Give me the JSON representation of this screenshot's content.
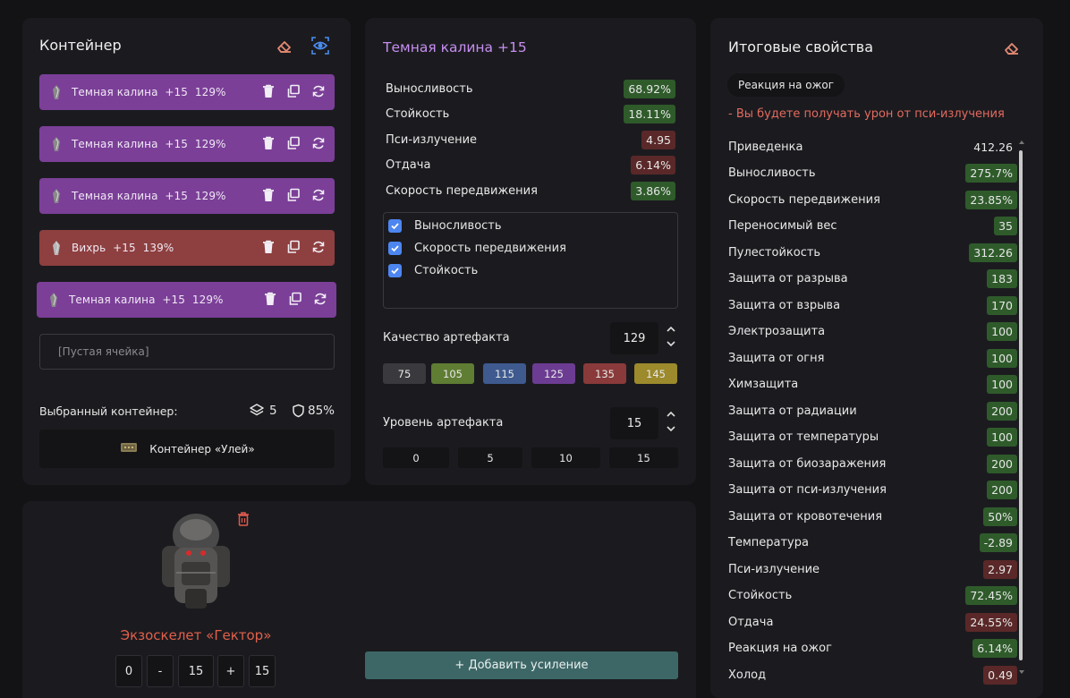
{
  "container_panel": {
    "title": "Контейнер",
    "slots": [
      {
        "label": "Темная калина  +15  129%",
        "color": "violet"
      },
      {
        "label": "Темная калина  +15  129%",
        "color": "violet"
      },
      {
        "label": "Темная калина  +15  129%",
        "color": "violet"
      },
      {
        "label": "Вихрь  +15  139%",
        "color": "red"
      },
      {
        "label": "Темная калина  +15  129%",
        "color": "violet"
      }
    ],
    "empty_slot": "[Пустая ячейка]",
    "selected_label": "Выбранный контейнер:",
    "capacity": "5",
    "protection": "85%",
    "container_name": "Контейнер «Улей»"
  },
  "artifact_panel": {
    "title": "Темная калина +15",
    "stats": [
      {
        "name": "Выносливость",
        "value": "68.92%",
        "kind": "g"
      },
      {
        "name": "Стойкость",
        "value": "18.11%",
        "kind": "g"
      },
      {
        "name": "Пси-излучение",
        "value": "4.95",
        "kind": "r"
      },
      {
        "name": "Отдача",
        "value": "6.14%",
        "kind": "r"
      },
      {
        "name": "Скорость передвижения",
        "value": "3.86%",
        "kind": "g"
      }
    ],
    "checked": [
      "Выносливость",
      "Скорость передвижения",
      "Стойкость"
    ],
    "quality_label": "Качество артефакта",
    "quality_value": "129",
    "quality_presets": [
      {
        "label": "75",
        "color": "#3a3a3e"
      },
      {
        "label": "105",
        "color": "#5f7d33"
      },
      {
        "label": "115",
        "color": "#3e5a8f"
      },
      {
        "label": "125",
        "color": "#6c3c92"
      },
      {
        "label": "135",
        "color": "#8a3a3a"
      },
      {
        "label": "145",
        "color": "#9c8a2c"
      }
    ],
    "level_label": "Уровень артефакта",
    "level_value": "15",
    "level_presets": [
      "0",
      "5",
      "10",
      "15"
    ]
  },
  "summary_panel": {
    "title": "Итоговые свойства",
    "tag": "Реакция на ожог",
    "warning": "- Вы будете получать урон от пси-излучения",
    "props": [
      {
        "name": "Приведенка",
        "value": "412.26",
        "kind": "n"
      },
      {
        "name": "Выносливость",
        "value": "275.7%",
        "kind": "g"
      },
      {
        "name": "Скорость передвижения",
        "value": "23.85%",
        "kind": "g"
      },
      {
        "name": "Переносимый вес",
        "value": "35",
        "kind": "g"
      },
      {
        "name": "Пулестойкость",
        "value": "312.26",
        "kind": "g"
      },
      {
        "name": "Защита от разрыва",
        "value": "183",
        "kind": "g"
      },
      {
        "name": "Защита от взрыва",
        "value": "170",
        "kind": "g"
      },
      {
        "name": "Электрозащита",
        "value": "100",
        "kind": "g"
      },
      {
        "name": "Защита от огня",
        "value": "100",
        "kind": "g"
      },
      {
        "name": "Химзащита",
        "value": "100",
        "kind": "g"
      },
      {
        "name": "Защита от радиации",
        "value": "200",
        "kind": "g"
      },
      {
        "name": "Защита от температуры",
        "value": "100",
        "kind": "g"
      },
      {
        "name": "Защита от биозаражения",
        "value": "200",
        "kind": "g"
      },
      {
        "name": "Защита от пси-излучения",
        "value": "200",
        "kind": "g"
      },
      {
        "name": "Защита от кровотечения",
        "value": "50%",
        "kind": "g"
      },
      {
        "name": "Температура",
        "value": "-2.89",
        "kind": "g"
      },
      {
        "name": "Пси-излучение",
        "value": "2.97",
        "kind": "r"
      },
      {
        "name": "Стойкость",
        "value": "72.45%",
        "kind": "g"
      },
      {
        "name": "Отдача",
        "value": "24.55%",
        "kind": "r"
      },
      {
        "name": "Реакция на ожог",
        "value": "6.14%",
        "kind": "g"
      },
      {
        "name": "Холод",
        "value": "0.49",
        "kind": "r"
      }
    ]
  },
  "armor_panel": {
    "name": "Экзоскелет «Гектор»",
    "ctrl": [
      "0",
      "-",
      "15",
      "+",
      "15"
    ],
    "add_boost": "+ Добавить усиление"
  },
  "colors": {
    "accent_violet": "#c68ef0",
    "warning_red": "#e36a5f",
    "armor_name": "#e0604c"
  }
}
